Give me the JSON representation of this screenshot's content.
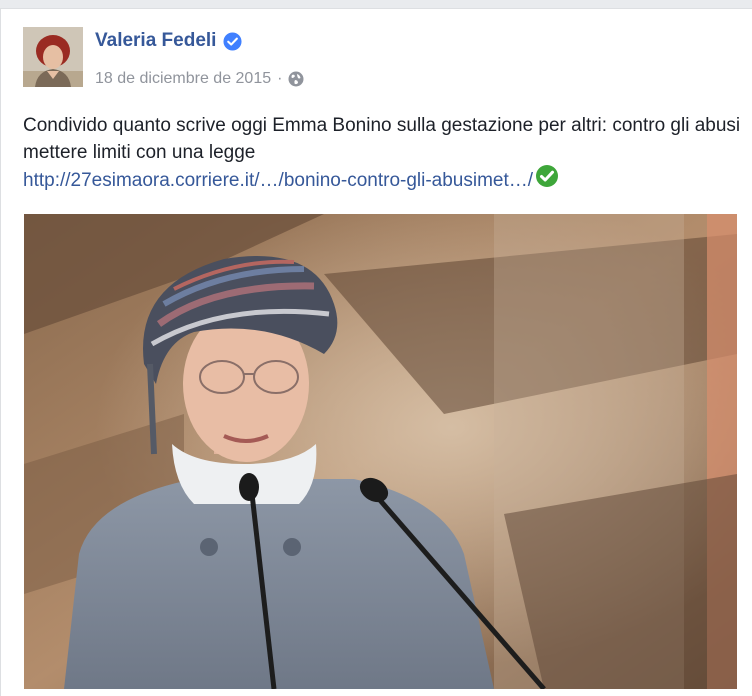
{
  "post": {
    "author": "Valeria Fedeli",
    "date": "18 de diciembre de 2015",
    "date_separator": "·",
    "privacy_icon": "globe-icon",
    "verified_icon": "verified-badge-icon",
    "text": "Condivido quanto scrive oggi Emma Bonino sulla gestazione per altri: contro gli abusi mettere limiti con una legge",
    "link": "http://27esimaora.corriere.it/…/bonino-contro-gli-abusimet…/",
    "link_emoji": "green-check-emoji-icon"
  },
  "colors": {
    "author": "#365899",
    "meta": "#90949c",
    "text": "#1d2129",
    "verified": "#4080ff",
    "check": "#3ea63a"
  }
}
